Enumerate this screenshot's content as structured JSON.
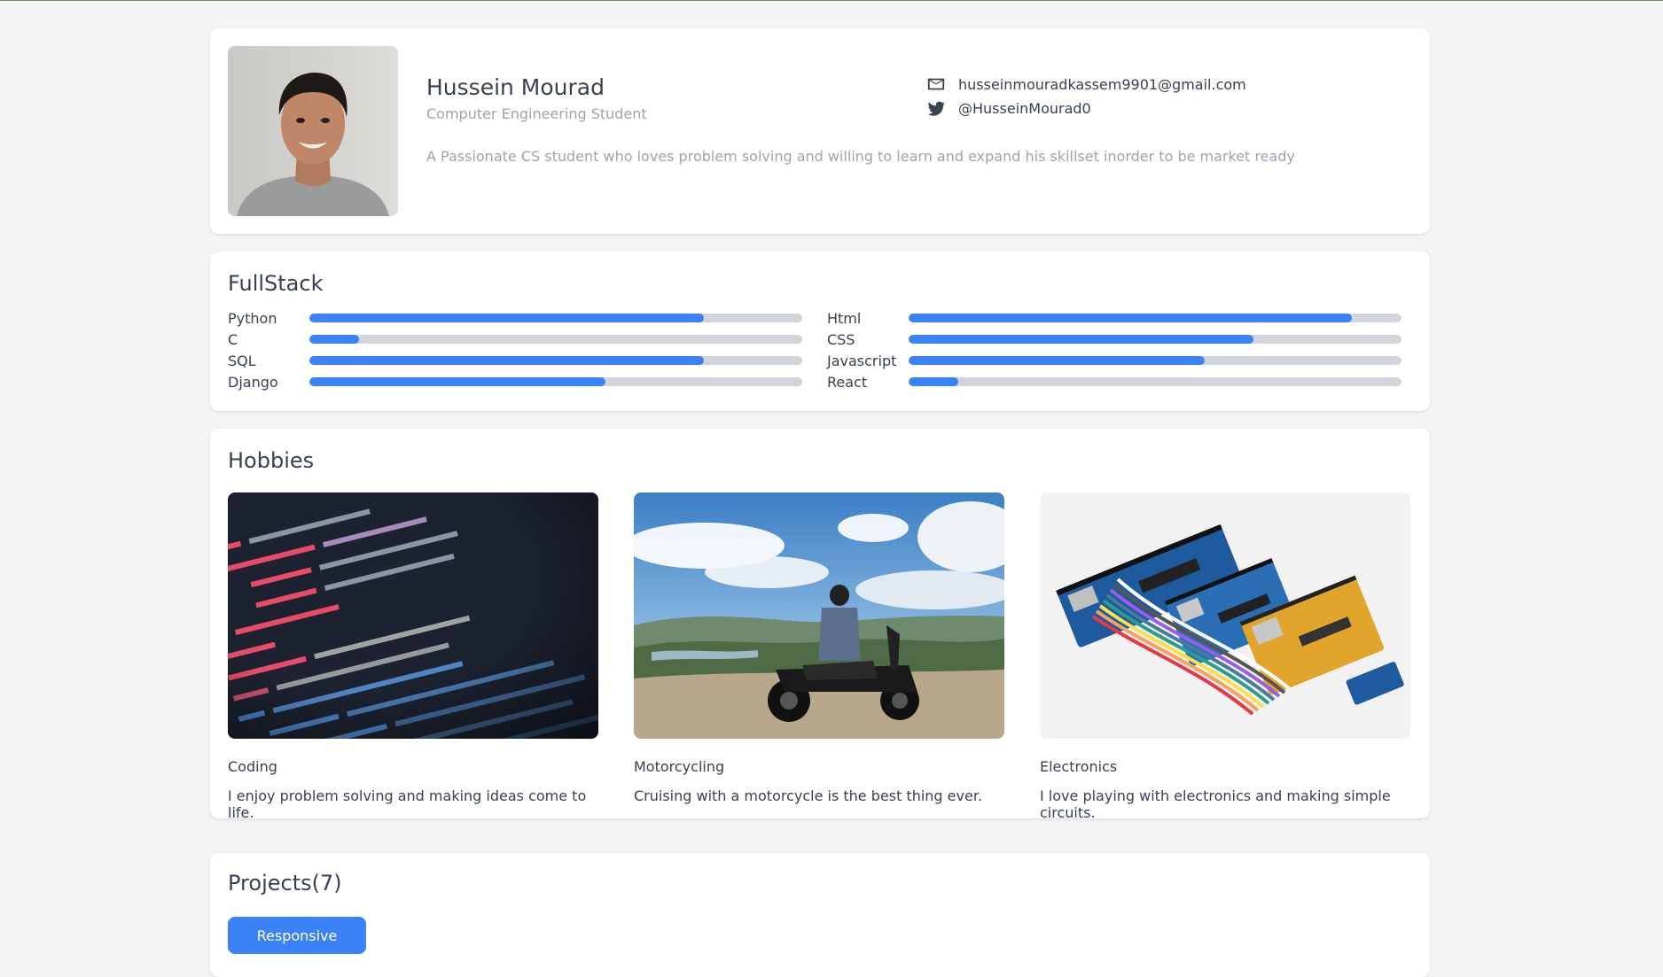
{
  "profile": {
    "name": "Hussein Mourad",
    "role": "Computer Engineering Student",
    "bio": "A Passionate CS student who loves problem solving and willing to learn and expand his skillset inorder to be market ready",
    "email": "husseinmouradkassem9901@gmail.com",
    "twitter": "@HusseinMourad0"
  },
  "skills": {
    "title": "FullStack",
    "accent": "#3b82f6",
    "track": "#d1d5db",
    "left": [
      {
        "label": "Python",
        "percent": 80
      },
      {
        "label": "C",
        "percent": 10
      },
      {
        "label": "SQL",
        "percent": 80
      },
      {
        "label": "Django",
        "percent": 60
      }
    ],
    "right": [
      {
        "label": "Html",
        "percent": 90
      },
      {
        "label": "CSS",
        "percent": 70
      },
      {
        "label": "Javascript",
        "percent": 60
      },
      {
        "label": "React",
        "percent": 10
      }
    ]
  },
  "hobbies": {
    "title": "Hobbies",
    "items": [
      {
        "title": "Coding",
        "desc": "I enjoy problem solving and making ideas come to life.",
        "image": "code-screen-image"
      },
      {
        "title": "Motorcycling",
        "desc": "Cruising with a motorcycle is the best thing ever.",
        "image": "motorcycle-landscape-image"
      },
      {
        "title": "Electronics",
        "desc": "I love playing with electronics and making simple circuits.",
        "image": "arduino-boards-image"
      }
    ]
  },
  "projects": {
    "title": "Projects(7)",
    "filter_button": "Responsive"
  }
}
